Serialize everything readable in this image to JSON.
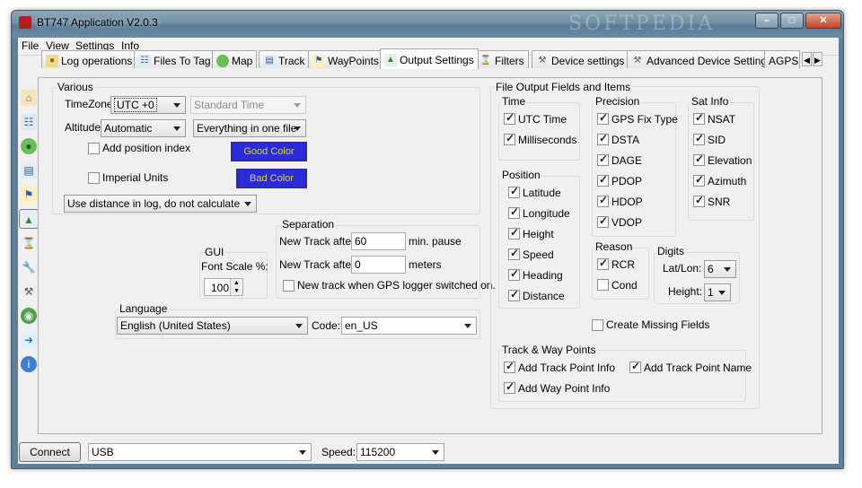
{
  "app": {
    "title": "BT747 Application V2.0.3"
  },
  "menu": [
    "File",
    "View",
    "Settings",
    "Info"
  ],
  "tabs": [
    "Log operations",
    "Files To Tag",
    "Map",
    "Track",
    "WayPoints",
    "Output Settings",
    "Filters",
    "Device settings",
    "Advanced Device Settings",
    "AGPS"
  ],
  "active_tab": "Output Settings",
  "watermark": "SOFTPEDIA",
  "various": {
    "title": "Various",
    "timezone_label": "TimeZone",
    "timezone_value": "UTC +0",
    "standard_time": "Standard Time",
    "altitude_label": "Altitude",
    "altitude_value": "Automatic",
    "file_split_value": "Everything in one file",
    "add_position_index": {
      "label": "Add position index",
      "checked": false
    },
    "imperial_units": {
      "label": "Imperial Units",
      "checked": false
    },
    "good_color": "Good Color",
    "bad_color": "Bad Color",
    "distance_value": "Use distance in log, do not calculate"
  },
  "gui": {
    "title": "GUI",
    "font_scale_label": "Font Scale %:",
    "font_scale_value": "100"
  },
  "separation": {
    "title": "Separation",
    "new_track_after_label": "New Track after",
    "min_value": "60",
    "min_unit": "min. pause",
    "new_track_after_label2": "New Track after",
    "meters_value": "0",
    "meters_unit": "meters",
    "gps_switched": {
      "label": "New track when GPS logger switched on.",
      "checked": false
    }
  },
  "language": {
    "title": "Language",
    "value": "English (United States)",
    "code_label": "Code:",
    "code_value": "en_US"
  },
  "output_fields": {
    "title": "File Output Fields and Items",
    "time": {
      "title": "Time",
      "items": [
        {
          "label": "UTC Time",
          "checked": true
        },
        {
          "label": "Milliseconds",
          "checked": true
        }
      ]
    },
    "precision": {
      "title": "Precision",
      "items": [
        {
          "label": "GPS Fix Type",
          "checked": true
        },
        {
          "label": "DSTA",
          "checked": true
        },
        {
          "label": "DAGE",
          "checked": true
        },
        {
          "label": "PDOP",
          "checked": true
        },
        {
          "label": "HDOP",
          "checked": true
        },
        {
          "label": "VDOP",
          "checked": true
        }
      ]
    },
    "satinfo": {
      "title": "Sat Info",
      "items": [
        {
          "label": "NSAT",
          "checked": true
        },
        {
          "label": "SID",
          "checked": true
        },
        {
          "label": "Elevation",
          "checked": true
        },
        {
          "label": "Azimuth",
          "checked": true
        },
        {
          "label": "SNR",
          "checked": true
        }
      ]
    },
    "position": {
      "title": "Position",
      "items": [
        {
          "label": "Latitude",
          "checked": true
        },
        {
          "label": "Longitude",
          "checked": true
        },
        {
          "label": "Height",
          "checked": true
        },
        {
          "label": "Speed",
          "checked": true
        },
        {
          "label": "Heading",
          "checked": true
        },
        {
          "label": "Distance",
          "checked": true
        }
      ]
    },
    "reason": {
      "title": "Reason",
      "items": [
        {
          "label": "RCR",
          "checked": true
        },
        {
          "label": "Cond",
          "checked": false
        }
      ]
    },
    "digits": {
      "title": "Digits",
      "latlon_label": "Lat/Lon:",
      "latlon_value": "6",
      "height_label": "Height:",
      "height_value": "1"
    },
    "create_missing": {
      "label": "Create Missing Fields",
      "checked": false
    },
    "trackway": {
      "title": "Track & Way Points",
      "add_track_point_info": {
        "label": "Add Track Point Info",
        "checked": true
      },
      "add_track_point_name": {
        "label": "Add Track Point Name",
        "checked": true
      },
      "add_way_point_info": {
        "label": "Add Way Point Info",
        "checked": true
      }
    }
  },
  "bottom": {
    "connect_label": "Connect",
    "port_value": "USB",
    "speed_label": "Speed:",
    "speed_value": "115200"
  },
  "colors": {
    "accent_blue": "#2b2bd9",
    "color_text": "#d8d63a",
    "frame": "#5f7f97"
  }
}
